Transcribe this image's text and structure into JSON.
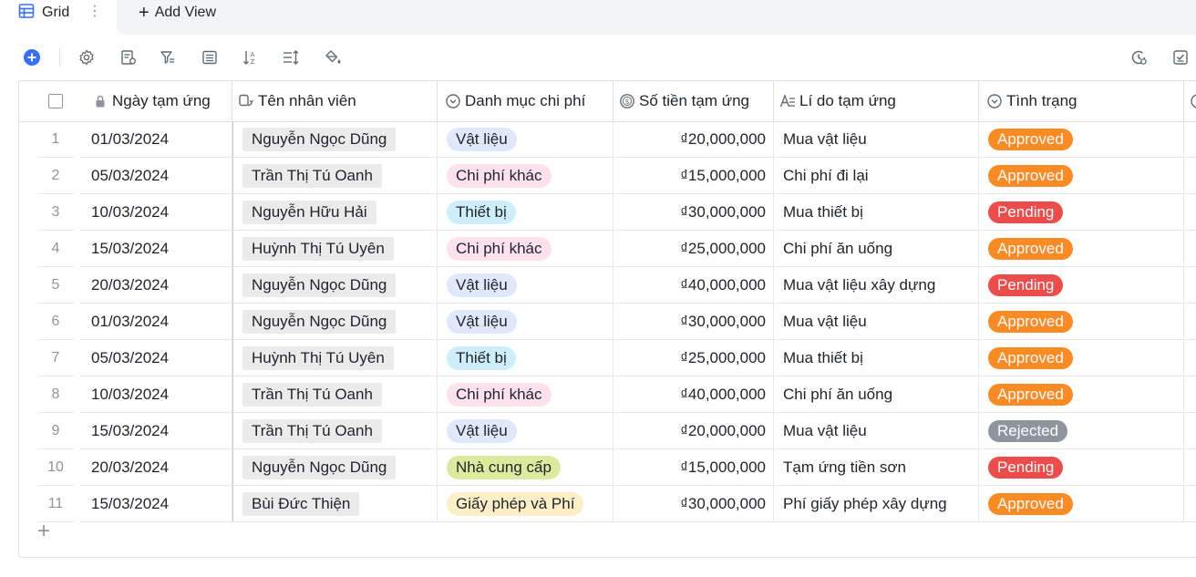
{
  "views": {
    "active_tab": "Grid",
    "add_view_label": "Add View"
  },
  "toolbar": {
    "icons": [
      "add-record-icon",
      "settings-icon",
      "field-settings-icon",
      "filter-icon",
      "group-icon",
      "sort-icon",
      "row-height-icon",
      "fill-color-icon",
      "history-icon",
      "checklist-icon"
    ]
  },
  "columns": {
    "date": "Ngày tạm ứng",
    "name": "Tên nhân viên",
    "category": "Danh mục chi phí",
    "amount": "Số tiền tạm ứng",
    "reason": "Lí do tạm ứng",
    "status": "Tình trạng"
  },
  "category_colors": {
    "Vật liệu": "#e0e9fb",
    "Chi phí khác": "#fde2ee",
    "Thiết bị": "#cdeefa",
    "Nhà cung cấp": "#dbeb9e",
    "Giấy phép và Phí": "#fcefc7"
  },
  "status_colors": {
    "Approved": "#fa8b24",
    "Pending": "#ee4b4b",
    "Rejected": "#8f959e"
  },
  "rows": [
    {
      "idx": "1",
      "date": "01/03/2024",
      "name": "Nguyễn Ngọc Dũng",
      "category": "Vật liệu",
      "amount": "₫20,000,000",
      "reason": "Mua vật liệu",
      "status": "Approved"
    },
    {
      "idx": "2",
      "date": "05/03/2024",
      "name": "Trần Thị Tú Oanh",
      "category": "Chi phí khác",
      "amount": "₫15,000,000",
      "reason": "Chi phí đi lại",
      "status": "Approved"
    },
    {
      "idx": "3",
      "date": "10/03/2024",
      "name": "Nguyễn Hữu Hải",
      "category": "Thiết bị",
      "amount": "₫30,000,000",
      "reason": "Mua thiết bị",
      "status": "Pending"
    },
    {
      "idx": "4",
      "date": "15/03/2024",
      "name": "Huỳnh Thị Tú Uyên",
      "category": "Chi phí khác",
      "amount": "₫25,000,000",
      "reason": "Chi phí ăn uống",
      "status": "Approved"
    },
    {
      "idx": "5",
      "date": "20/03/2024",
      "name": "Nguyễn Ngọc Dũng",
      "category": "Vật liệu",
      "amount": "₫40,000,000",
      "reason": "Mua vật liệu xây dựng",
      "status": "Pending"
    },
    {
      "idx": "6",
      "date": "01/03/2024",
      "name": "Nguyễn Ngọc Dũng",
      "category": "Vật liệu",
      "amount": "₫30,000,000",
      "reason": "Mua vật liệu",
      "status": "Approved"
    },
    {
      "idx": "7",
      "date": "05/03/2024",
      "name": "Huỳnh Thị Tú Uyên",
      "category": "Thiết bị",
      "amount": "₫25,000,000",
      "reason": "Mua thiết bị",
      "status": "Approved"
    },
    {
      "idx": "8",
      "date": "10/03/2024",
      "name": "Trần Thị Tú Oanh",
      "category": "Chi phí khác",
      "amount": "₫40,000,000",
      "reason": "Chi phí ăn uống",
      "status": "Approved"
    },
    {
      "idx": "9",
      "date": "15/03/2024",
      "name": "Trần Thị Tú Oanh",
      "category": "Vật liệu",
      "amount": "₫20,000,000",
      "reason": "Mua vật liệu",
      "status": "Rejected"
    },
    {
      "idx": "10",
      "date": "20/03/2024",
      "name": "Nguyễn Ngọc Dũng",
      "category": "Nhà cung cấp",
      "amount": "₫15,000,000",
      "reason": "Tạm ứng tiền sơn",
      "status": "Pending"
    },
    {
      "idx": "11",
      "date": "15/03/2024",
      "name": "Bùi Đức Thiện",
      "category": "Giấy phép và Phí",
      "amount": "₫30,000,000",
      "reason": "Phí giấy phép xây dựng",
      "status": "Approved"
    }
  ]
}
